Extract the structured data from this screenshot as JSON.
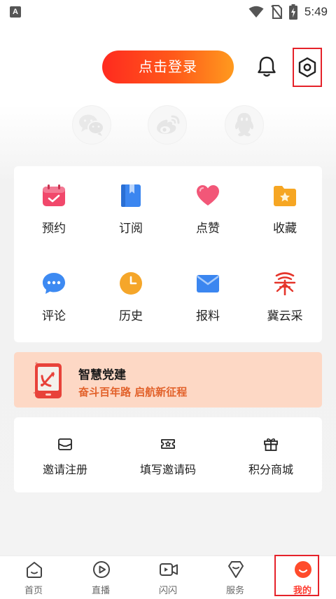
{
  "status_bar": {
    "app_icon_letter": "A",
    "time": "5:49",
    "icons": [
      "wifi-icon",
      "no-sim-icon",
      "battery-charging-icon"
    ]
  },
  "header": {
    "login_label": "点击登录",
    "bell_icon": "bell-icon",
    "settings_icon": "settings-hexagon-icon"
  },
  "social_login": [
    {
      "icon": "wechat-icon"
    },
    {
      "icon": "weibo-icon"
    },
    {
      "icon": "qq-icon"
    }
  ],
  "grid": [
    {
      "label": "预约",
      "icon": "calendar-check-icon",
      "color": "#f1486b"
    },
    {
      "label": "订阅",
      "icon": "bookmark-book-icon",
      "color": "#3b86f0"
    },
    {
      "label": "点赞",
      "icon": "heart-icon",
      "color": "#f25778"
    },
    {
      "label": "收藏",
      "icon": "star-folder-icon",
      "color": "#f6a623"
    },
    {
      "label": "评论",
      "icon": "comment-bubble-icon",
      "color": "#3d8af2"
    },
    {
      "label": "历史",
      "icon": "clock-icon",
      "color": "#f5a62a"
    },
    {
      "label": "报料",
      "icon": "envelope-icon",
      "color": "#3b86f0"
    },
    {
      "label": "冀云采",
      "icon": "jiyuncai-logo-icon",
      "color": "#e5352b"
    }
  ],
  "party_banner": {
    "title": "智慧党建",
    "subtitle": "奋斗百年路 启航新征程",
    "icon": "party-emblem-phone-icon"
  },
  "invite": [
    {
      "label": "邀请注册",
      "icon": "mail-icon"
    },
    {
      "label": "填写邀请码",
      "icon": "ticket-star-icon"
    },
    {
      "label": "积分商城",
      "icon": "gift-icon"
    }
  ],
  "bottom_nav": [
    {
      "label": "首页",
      "icon": "home-icon"
    },
    {
      "label": "直播",
      "icon": "play-circle-icon"
    },
    {
      "label": "闪闪",
      "icon": "video-camera-icon"
    },
    {
      "label": "服务",
      "icon": "diamond-service-icon"
    },
    {
      "label": "我的",
      "icon": "me-smile-icon",
      "active": true
    }
  ],
  "colors": {
    "accent": "#ff3b2f",
    "login_gradient_start": "#ff2a1f",
    "login_gradient_end": "#ff9a1e",
    "party_bg": "#fdd8c5",
    "party_sub": "#e2612a"
  }
}
